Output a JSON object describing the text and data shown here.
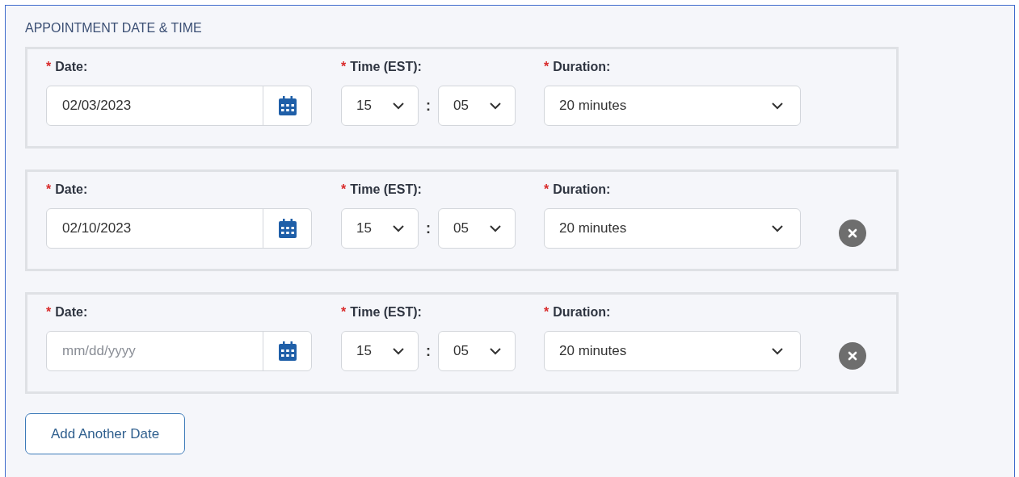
{
  "section_title": "APPOINTMENT DATE & TIME",
  "rows": [
    {
      "date": {
        "mark": "*",
        "label": "Date:",
        "value": "02/03/2023"
      },
      "time": {
        "mark": "*",
        "label": "Time (EST):",
        "hour": "15",
        "separator": ":",
        "minute": "05"
      },
      "duration": {
        "mark": "*",
        "label": "Duration:",
        "value": "20 minutes"
      },
      "removable": false
    },
    {
      "date": {
        "mark": "*",
        "label": "Date:",
        "value": "02/10/2023"
      },
      "time": {
        "mark": "*",
        "label": "Time (EST):",
        "hour": "15",
        "separator": ":",
        "minute": "05"
      },
      "duration": {
        "mark": "*",
        "label": "Duration:",
        "value": "20 minutes"
      },
      "removable": true
    },
    {
      "date": {
        "mark": "*",
        "label": "Date:",
        "placeholder": "mm/dd/yyyy"
      },
      "time": {
        "mark": "*",
        "label": "Time (EST):",
        "hour": "15",
        "separator": ":",
        "minute": "05"
      },
      "duration": {
        "mark": "*",
        "label": "Duration:",
        "value": "20 minutes"
      },
      "removable": true
    }
  ],
  "add_button": "Add Another Date"
}
